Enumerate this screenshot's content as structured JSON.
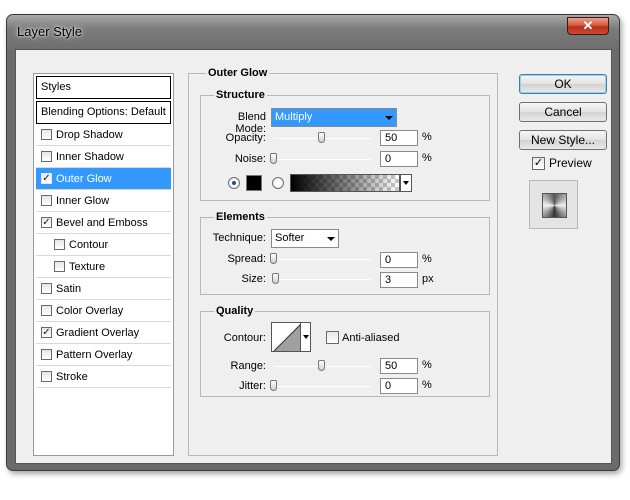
{
  "window": {
    "title": "Layer Style",
    "close_glyph": "✕"
  },
  "sidebar": {
    "header": "Styles",
    "blend_options": "Blending Options: Default",
    "items": [
      {
        "label": "Drop Shadow",
        "checked": false
      },
      {
        "label": "Inner Shadow",
        "checked": false
      },
      {
        "label": "Outer Glow",
        "checked": true,
        "selected": true
      },
      {
        "label": "Inner Glow",
        "checked": false
      },
      {
        "label": "Bevel and Emboss",
        "checked": true
      },
      {
        "label": "Contour",
        "checked": false,
        "sub": true
      },
      {
        "label": "Texture",
        "checked": false,
        "sub": true
      },
      {
        "label": "Satin",
        "checked": false
      },
      {
        "label": "Color Overlay",
        "checked": false
      },
      {
        "label": "Gradient Overlay",
        "checked": true
      },
      {
        "label": "Pattern Overlay",
        "checked": false
      },
      {
        "label": "Stroke",
        "checked": false
      }
    ]
  },
  "panel": {
    "title": "Outer Glow",
    "structure": {
      "title": "Structure",
      "blend_mode_label": "Blend Mode:",
      "blend_mode_value": "Multiply",
      "opacity_label": "Opacity:",
      "opacity_value": "50",
      "noise_label": "Noise:",
      "noise_value": "0",
      "percent": "%",
      "color_selected": "solid",
      "color_hex": "#000000"
    },
    "elements": {
      "title": "Elements",
      "technique_label": "Technique:",
      "technique_value": "Softer",
      "spread_label": "Spread:",
      "spread_value": "0",
      "size_label": "Size:",
      "size_value": "3",
      "percent": "%",
      "px": "px"
    },
    "quality": {
      "title": "Quality",
      "contour_label": "Contour:",
      "anti_aliased_label": "Anti-aliased",
      "range_label": "Range:",
      "range_value": "50",
      "jitter_label": "Jitter:",
      "jitter_value": "0",
      "percent": "%"
    }
  },
  "buttons": {
    "ok": "OK",
    "cancel": "Cancel",
    "new_style": "New Style...",
    "preview_label": "Preview",
    "check": "✓"
  },
  "colors": {
    "selection": "#3399ff",
    "dialog_bg": "#efefef",
    "glow_color": "#000000"
  }
}
